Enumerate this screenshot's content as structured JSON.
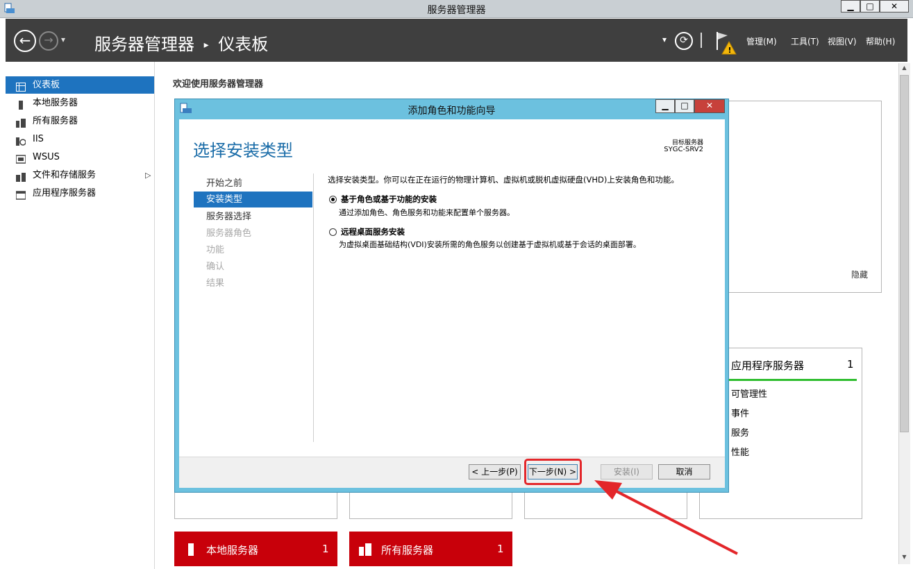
{
  "os": {
    "title": "服务器管理器",
    "min": "▁",
    "max": "□",
    "close": "✕"
  },
  "header": {
    "breadcrumb_app": "服务器管理器",
    "breadcrumb_sep": "▸",
    "breadcrumb_page": "仪表板",
    "menus": [
      "管理(M)",
      "工具(T)",
      "视图(V)",
      "帮助(H)"
    ]
  },
  "sidebar": {
    "items": [
      {
        "label": "仪表板",
        "icon": "dashboard-icon"
      },
      {
        "label": "本地服务器",
        "icon": "server-icon"
      },
      {
        "label": "所有服务器",
        "icon": "servers-icon"
      },
      {
        "label": "IIS",
        "icon": "iis-icon"
      },
      {
        "label": "WSUS",
        "icon": "wsus-icon"
      },
      {
        "label": "文件和存储服务",
        "icon": "storage-icon"
      },
      {
        "label": "应用程序服务器",
        "icon": "app-server-icon"
      }
    ],
    "expand_glyph": "▷"
  },
  "main": {
    "welcome": "欢迎使用服务器管理器",
    "hide": "隐藏",
    "tile_app": {
      "title": "应用程序服务器",
      "count": "1",
      "rows": [
        "可管理性",
        "事件",
        "服务",
        "性能"
      ]
    },
    "tile_local": {
      "title": "本地服务器",
      "count": "1"
    },
    "tile_all": {
      "title": "所有服务器",
      "count": "1"
    }
  },
  "dialog": {
    "title": "添加角色和功能向导",
    "heading": "选择安装类型",
    "target_label": "目标服务器",
    "target_value": "SYGC-SRV2",
    "steps": [
      "开始之前",
      "安装类型",
      "服务器选择",
      "服务器角色",
      "功能",
      "确认",
      "结果"
    ],
    "intro": "选择安装类型。你可以在正在运行的物理计算机、虚拟机或脱机虚拟硬盘(VHD)上安装角色和功能。",
    "options": [
      {
        "label": "基于角色或基于功能的安装",
        "desc": "通过添加角色、角色服务和功能来配置单个服务器。",
        "selected": true
      },
      {
        "label": "远程桌面服务安装",
        "desc": "为虚拟桌面基础结构(VDI)安装所需的角色服务以创建基于虚拟机或基于会话的桌面部署。",
        "selected": false
      }
    ],
    "buttons": {
      "prev": "< 上一步(P)",
      "next": "下一步(N) >",
      "install": "安装(I)",
      "cancel": "取消"
    }
  },
  "colors": {
    "accent": "#1e73bf",
    "header": "#3f3f3f",
    "dialog_frame": "#6cc1df",
    "tile_red": "#c8000a",
    "highlight": "#e3262a"
  }
}
